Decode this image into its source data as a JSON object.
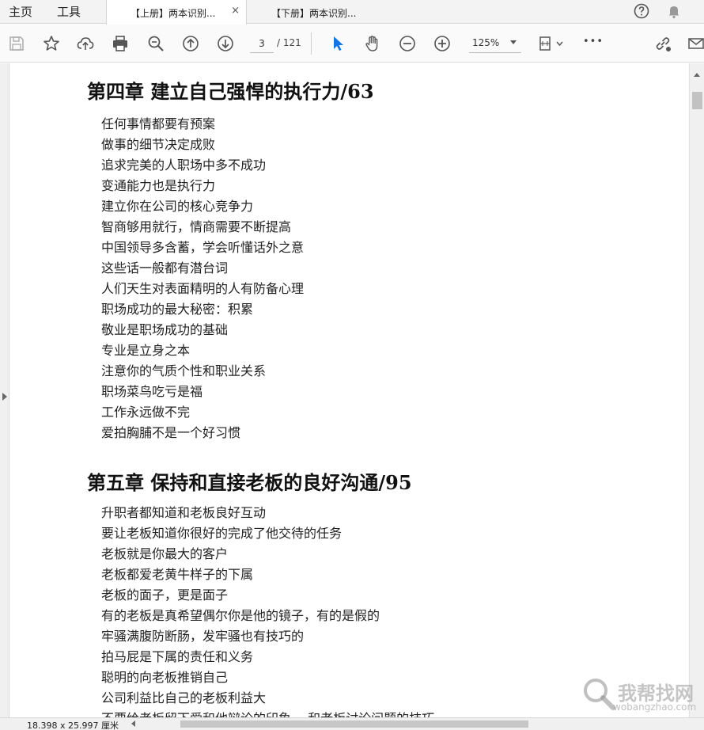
{
  "tabbar": {
    "home": "主页",
    "tools": "工具",
    "tabs": [
      {
        "label": "【上册】两本识别...",
        "active": true
      },
      {
        "label": "【下册】两本识别...",
        "active": false
      }
    ],
    "close_glyph": "×"
  },
  "toolbar": {
    "page_current": "3",
    "page_total": "/ 121",
    "zoom": "125%",
    "more_glyph": "•••"
  },
  "document": {
    "chapters": [
      {
        "title": "第四章  建立自己强悍的执行力/63",
        "items": [
          "任何事情都要有预案",
          "做事的细节决定成败",
          "追求完美的人职场中多不成功",
          "变通能力也是执行力",
          "建立你在公司的核心竞争力",
          "智商够用就行，情商需要不断提高",
          "中国领导多含蓄，学会听懂话外之意",
          "这些话一般都有潜台词",
          "人们天生对表面精明的人有防备心理",
          "职场成功的最大秘密：积累",
          "敬业是职场成功的基础",
          "专业是立身之本",
          "注意你的气质个性和职业关系",
          "职场菜鸟吃亏是福",
          "工作永远做不完",
          "爱拍胸脯不是一个好习惯"
        ]
      },
      {
        "title": "第五章  保持和直接老板的良好沟通/95",
        "items": [
          "升职者都知道和老板良好互动",
          "要让老板知道你很好的完成了他交待的任务",
          "老板就是你最大的客户",
          "老板都爱老黄牛样子的下属",
          "老板的面子，更是面子",
          "有的老板是真希望偶尔你是他的镜子，有的是假的",
          "牢骚满腹防断肠，发牢骚也有技巧的",
          "拍马屁是下属的责任和义务",
          "聪明的向老板推销自己",
          "公司利益比自己的老板利益大",
          "不要给老板留下爱和他辩论的印象，  和老板讨论问题的技巧"
        ]
      }
    ]
  },
  "status": {
    "dimensions": "18.398 x 25.997 厘米"
  },
  "watermark": {
    "text": "我帮找网",
    "sub": "wobangzhao.com"
  },
  "colors": {
    "accent_blue": "#1473e6",
    "icon_gray": "#555555"
  }
}
